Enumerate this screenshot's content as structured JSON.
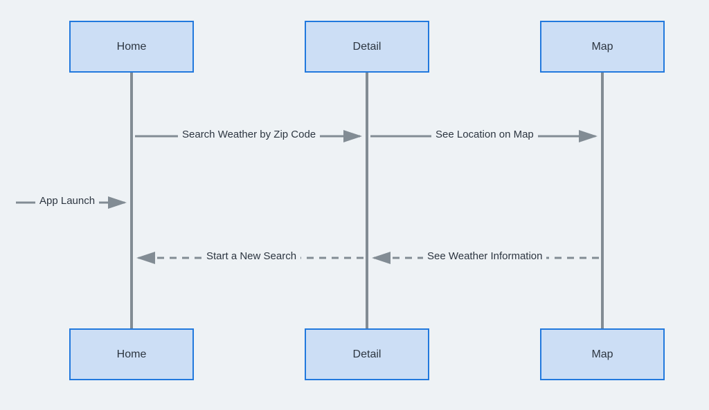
{
  "nodes": {
    "home_top": "Home",
    "detail_top": "Detail",
    "map_top": "Map",
    "home_bottom": "Home",
    "detail_bottom": "Detail",
    "map_bottom": "Map"
  },
  "messages": {
    "app_launch": "App Launch",
    "search_zip": "Search Weather by Zip Code",
    "see_location": "See Location on Map",
    "start_new_search": "Start a New Search",
    "see_weather_info": "See Weather Information"
  },
  "colors": {
    "node_fill": "#ccdef5",
    "node_border": "#2178dd",
    "line": "#828c94",
    "text": "#2c3540",
    "bg": "#eef2f5"
  }
}
